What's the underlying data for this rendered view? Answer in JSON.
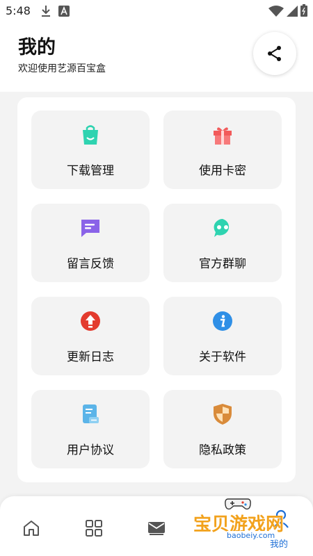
{
  "status_bar": {
    "time": "5:48"
  },
  "header": {
    "title": "我的",
    "subtitle": "欢迎使用艺源百宝盒"
  },
  "menu": {
    "items": [
      {
        "label": "下载管理",
        "icon": "shopping-bag-icon",
        "color": "#2ed3b0"
      },
      {
        "label": "使用卡密",
        "icon": "gift-icon",
        "color": "#f25a5a"
      },
      {
        "label": "留言反馈",
        "icon": "message-icon",
        "color": "#8a63e8"
      },
      {
        "label": "官方群聊",
        "icon": "chat-bot-icon",
        "color": "#2ed3b0"
      },
      {
        "label": "更新日志",
        "icon": "update-arrow-icon",
        "color": "#e33b2e"
      },
      {
        "label": "关于软件",
        "icon": "info-icon",
        "color": "#2f8fe6"
      },
      {
        "label": "用户协议",
        "icon": "document-icon",
        "color": "#5bb4e8"
      },
      {
        "label": "隐私政策",
        "icon": "shield-icon",
        "color": "#d98b3a"
      }
    ]
  },
  "bottom_nav": {
    "items": [
      {
        "icon": "home-icon"
      },
      {
        "icon": "grid-icon"
      },
      {
        "icon": "mail-icon"
      },
      {
        "icon": "person-icon",
        "label": "我的",
        "active": true
      }
    ],
    "active_color": "#1e6fd6"
  },
  "watermark": {
    "text": "宝贝游戏网",
    "url": "baobeiy.com"
  }
}
